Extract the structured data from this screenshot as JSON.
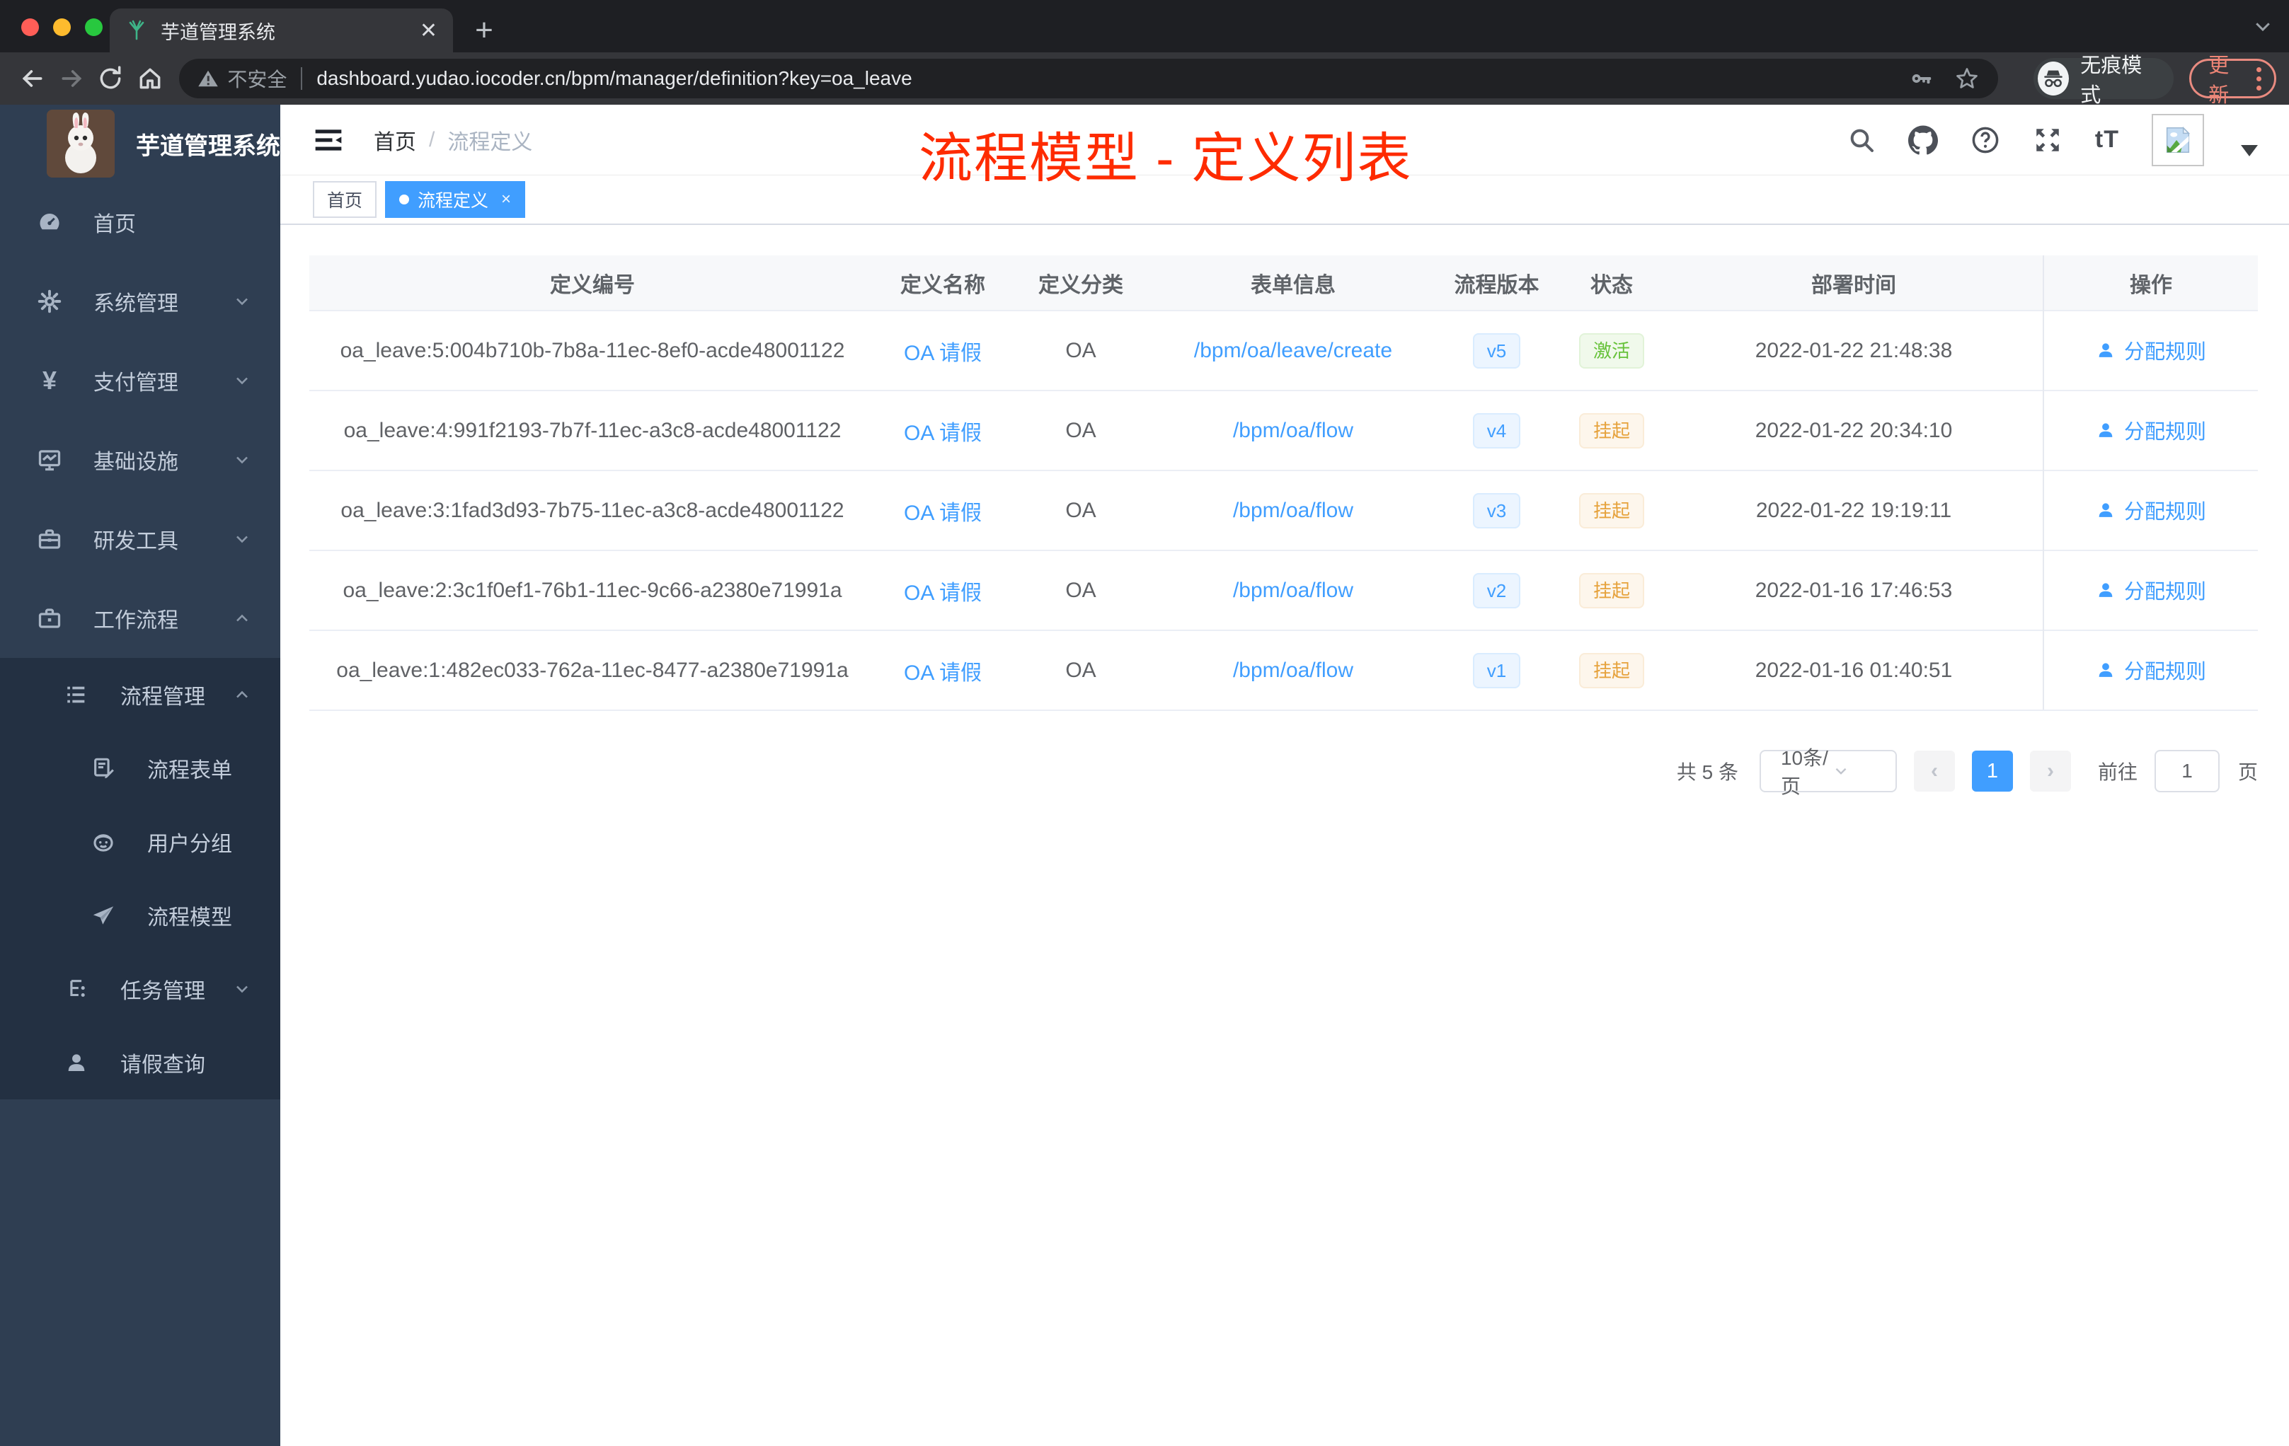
{
  "browser": {
    "tab_title": "芋道管理系统",
    "new_tab": "+",
    "close_tab": "✕",
    "security_label": "不安全",
    "url": "dashboard.yudao.iocoder.cn/bpm/manager/definition?key=oa_leave",
    "incognito_label": "无痕模式",
    "update_label": "更新"
  },
  "sidebar": {
    "brand": "芋道管理系统",
    "items": [
      {
        "label": "首页"
      },
      {
        "label": "系统管理"
      },
      {
        "label": "支付管理"
      },
      {
        "label": "基础设施"
      },
      {
        "label": "研发工具"
      },
      {
        "label": "工作流程"
      },
      {
        "label": "流程管理"
      },
      {
        "label": "流程表单"
      },
      {
        "label": "用户分组"
      },
      {
        "label": "流程模型"
      },
      {
        "label": "任务管理"
      },
      {
        "label": "请假查询"
      }
    ]
  },
  "header": {
    "breadcrumb": {
      "home": "首页",
      "separator": "/",
      "current": "流程定义"
    },
    "annotation": "流程模型 - 定义列表",
    "text_size_icon_label": "tT"
  },
  "tags": {
    "home": {
      "label": "首页"
    },
    "current": {
      "label": "流程定义",
      "close": "×"
    }
  },
  "table": {
    "columns": {
      "id": "定义编号",
      "name": "定义名称",
      "category": "定义分类",
      "form": "表单信息",
      "version": "流程版本",
      "status": "状态",
      "deploy_time": "部署时间",
      "action": "操作"
    },
    "rows": [
      {
        "id": "oa_leave:5:004b710b-7b8a-11ec-8ef0-acde48001122",
        "name": "OA 请假",
        "category": "OA",
        "form": "/bpm/oa/leave/create",
        "version": "v5",
        "status": {
          "label": "激活",
          "color": "green"
        },
        "deploy_time": "2022-01-22 21:48:38",
        "action": "分配规则"
      },
      {
        "id": "oa_leave:4:991f2193-7b7f-11ec-a3c8-acde48001122",
        "name": "OA 请假",
        "category": "OA",
        "form": "/bpm/oa/flow",
        "version": "v4",
        "status": {
          "label": "挂起",
          "color": "orange"
        },
        "deploy_time": "2022-01-22 20:34:10",
        "action": "分配规则"
      },
      {
        "id": "oa_leave:3:1fad3d93-7b75-11ec-a3c8-acde48001122",
        "name": "OA 请假",
        "category": "OA",
        "form": "/bpm/oa/flow",
        "version": "v3",
        "status": {
          "label": "挂起",
          "color": "orange"
        },
        "deploy_time": "2022-01-22 19:19:11",
        "action": "分配规则"
      },
      {
        "id": "oa_leave:2:3c1f0ef1-76b1-11ec-9c66-a2380e71991a",
        "name": "OA 请假",
        "category": "OA",
        "form": "/bpm/oa/flow",
        "version": "v2",
        "status": {
          "label": "挂起",
          "color": "orange"
        },
        "deploy_time": "2022-01-16 17:46:53",
        "action": "分配规则"
      },
      {
        "id": "oa_leave:1:482ec033-762a-11ec-8477-a2380e71991a",
        "name": "OA 请假",
        "category": "OA",
        "form": "/bpm/oa/flow",
        "version": "v1",
        "status": {
          "label": "挂起",
          "color": "orange"
        },
        "deploy_time": "2022-01-16 01:40:51",
        "action": "分配规则"
      }
    ]
  },
  "pagination": {
    "total_text": "共 5 条",
    "page_size": "10条/页",
    "prev": "‹",
    "next": "›",
    "current_page": "1",
    "goto_label": "前往",
    "goto_value": "1",
    "page_unit": "页"
  },
  "colors": {
    "accent_blue": "#409eff",
    "sidebar_bg": "#2f3e52",
    "submenu_bg": "#233042",
    "annotation_red": "#fe2b00",
    "status_active_green": "#67c23a",
    "status_suspended_orange": "#e6a23c"
  }
}
